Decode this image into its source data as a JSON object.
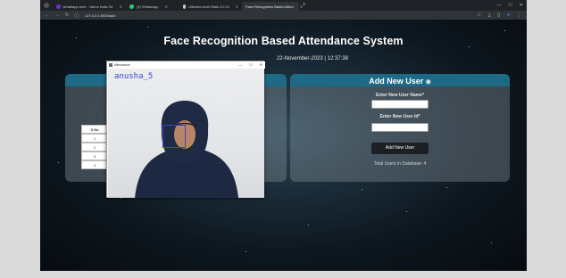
{
  "browser": {
    "tabs": [
      {
        "label": "whatsapp web - Yahoo India Se",
        "icon": "yahoo-favicon",
        "color": "#6e2bd9"
      },
      {
        "label": "(2) WhatsApp",
        "icon": "whatsapp-favicon",
        "color": "#25d366"
      },
      {
        "label": "Ultimate Auth Rails 4.0 Gi",
        "icon": "github-favicon",
        "color": "#cccccc"
      },
      {
        "label": "Face Recognition Based Atten",
        "icon": "app-favicon",
        "color": "#6b7a8a"
      }
    ],
    "url": "127.0.0.1:5000/add"
  },
  "page": {
    "title": "Face Recognition Based Attendance System",
    "datetime": "22-November-2023 | 12:37:38"
  },
  "attendance_table": {
    "header": "S No",
    "rows": [
      "1",
      "2",
      "3",
      "4"
    ]
  },
  "add_user": {
    "heading": "Add New User",
    "heading_icon": "user-add-icon",
    "name_label": "Enter New User Name*",
    "id_label": "Enter New User Id*",
    "name_value": "",
    "id_value": "",
    "button": "Add New User",
    "total": "Total Users in Database: 4"
  },
  "camera_window": {
    "title": "Attendance",
    "detected_name": "anusha_5"
  }
}
